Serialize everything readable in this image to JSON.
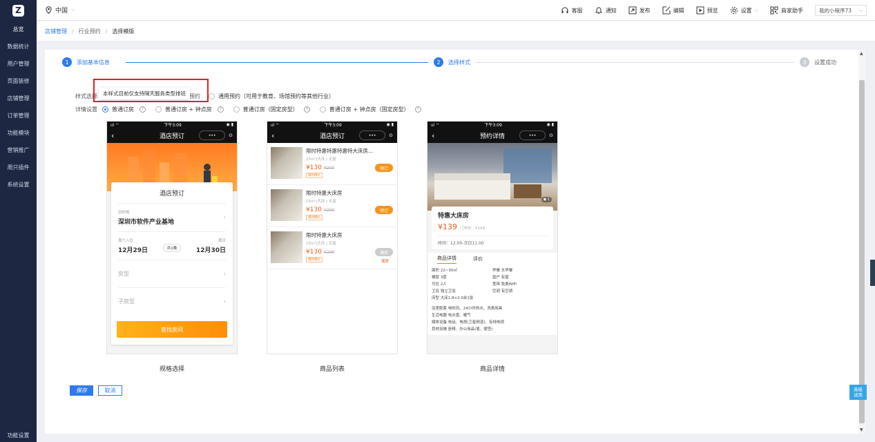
{
  "sidebar": {
    "items": [
      "总览",
      "数据统计",
      "用户管理",
      "页面装修",
      "店铺管理",
      "订单管理",
      "功能模块",
      "营销推广",
      "周只插件",
      "系统设置"
    ],
    "bottom": "功能设置"
  },
  "topbar": {
    "location": "中国",
    "items": [
      {
        "label": "客服",
        "icon": "headset-icon"
      },
      {
        "label": "通知",
        "icon": "bell-icon"
      },
      {
        "label": "发布",
        "icon": "publish-icon"
      },
      {
        "label": "编辑",
        "icon": "edit-icon"
      },
      {
        "label": "预览",
        "icon": "preview-icon"
      },
      {
        "label": "设置",
        "icon": "gear-icon"
      },
      {
        "label": "商家助手",
        "icon": "qrcode-icon"
      }
    ],
    "program_select": "我的小程序73"
  },
  "breadcrumb": {
    "items": [
      "店铺管理",
      "行业预约",
      "选择模版"
    ]
  },
  "steps": [
    {
      "num": "1",
      "label": "添加基本信息"
    },
    {
      "num": "2",
      "label": "选择样式"
    },
    {
      "num": "3",
      "label": "设置成功"
    }
  ],
  "options": {
    "style_label": "样式选择",
    "style_hidden": "预约",
    "style_option": "通用预约（可用于教育、场馆预约等其他行业）",
    "tooltip": "本样式目前仅支持隔天服务类型排班",
    "detail_label": "详情设置",
    "detail_options": [
      "普通订房",
      "普通订房 + 钟点房",
      "普通订房（固定房型）",
      "普通订房 + 钟点房（固定房型）"
    ]
  },
  "phones": {
    "status_time": "下午3:09",
    "p1": {
      "title": "酒店预订",
      "card_title": "酒店预订",
      "dest_label": "目的地",
      "dest": "深圳市软件产业基地",
      "checkin_label": "周六入住",
      "checkin": "12月29日",
      "nights": "共1晚",
      "checkout_label": "周日",
      "checkout": "12月30日",
      "room_type": "房型",
      "sub_type": "子房型",
      "btn": "查找房间",
      "caption": "规格选择"
    },
    "p2": {
      "title": "酒店预订",
      "caption": "商品列表",
      "items": [
        {
          "title": "限时特惠特惠特惠特大床房...",
          "sub": "15m²|大床 | 无窗",
          "price": "¥130",
          "old": "¥200",
          "tag": "限时特价",
          "btn": "预订"
        },
        {
          "title": "限时特惠大床房",
          "sub": "15m²|大床 | 无窗",
          "price": "¥130",
          "old": "¥200",
          "tag": "限时特价",
          "btn": "预订"
        },
        {
          "title": "限时特惠大床房",
          "sub": "15m²|大床 | 无窗",
          "price": "¥130",
          "old": "¥200",
          "tag": "限时特价",
          "btn": "满房",
          "full": "满房"
        }
      ]
    },
    "p3": {
      "title": "预约详情",
      "room": "特惠大床房",
      "price": "¥139",
      "store_price": "门市价：¥199",
      "time": "时间：12:00-次日11:00",
      "tab1": "商品详情",
      "tab2": "评价",
      "specs": [
        "面积  22~30㎡",
        "早餐  无早餐",
        "楼层  3层",
        "窗户  有窗",
        "可住  2人",
        "宽带  免费WiFi",
        "卫浴  独立卫浴",
        "空调  有空调",
        "床型  大床1.8×2.0米1张"
      ],
      "facilities": [
        "浴室配套  电吹风、24小时热水、洗漱用具",
        "生活电器  电水壶、暖气",
        "媒体设备  电话、电视(卫星频道)、有线电视",
        "其他设施  座椅、办公用品(笔、便签)"
      ],
      "caption": "商品详情"
    }
  },
  "actions": {
    "save": "保存",
    "cancel": "取消"
  },
  "float": {
    "line1": "高级",
    "line2": "试用"
  },
  "colors": {
    "accent": "#2f7ae8",
    "sidebar": "#1d2741",
    "orange": "#f7941d"
  }
}
